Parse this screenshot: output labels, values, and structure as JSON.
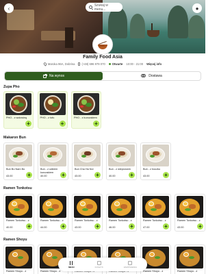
{
  "header": {
    "search_placeholder": "Szukaj w menu..."
  },
  "restaurant": {
    "name": "Family Food Asia",
    "address": "Maroka 96A, Dobrina",
    "phone": "(+48) 696 979 070",
    "status": "Otwarte",
    "hours": "10:00 - 21:00",
    "more_info": "Więcej info"
  },
  "order_toggle": {
    "options": [
      "Na wynos",
      "Dostawa"
    ],
    "active": "Na wynos"
  },
  "sections": [
    {
      "title": "Zupa Pho",
      "items": [
        {
          "name": "PHO - z wołowiną",
          "price": "43.00"
        },
        {
          "name": "PHO - z tofu",
          "price": "40.00"
        },
        {
          "name": "PHO - z kurczakiem",
          "price": "40.00"
        }
      ]
    },
    {
      "title": "Makaron Bun",
      "items": [
        {
          "name": "Bun Bo Nam Bo",
          "price": "43.00"
        },
        {
          "name": "Bun - z udkiem kurczakiem",
          "price": "40.00"
        },
        {
          "name": "Bun Cha Ha Noi",
          "price": "43.00"
        },
        {
          "name": "Bun - z wieprzowin",
          "price": "40.00"
        },
        {
          "name": "Bun - z boczku",
          "price": "43.00"
        }
      ]
    },
    {
      "title": "Ramen Tonkotsu",
      "items": [
        {
          "name": "Ramen Tonkotsu - z",
          "price": "40.00"
        },
        {
          "name": "Ramen Tonkotsu - z",
          "price": "44.00"
        },
        {
          "name": "Ramen Tonkotsu - z",
          "price": "43.00"
        },
        {
          "name": "Ramen Tonkotsu - z",
          "price": "46.00"
        },
        {
          "name": "Ramen Tonkotsu - z",
          "price": "47.00"
        },
        {
          "name": "Ramen Tonkotsu - z",
          "price": "43.00"
        }
      ]
    },
    {
      "title": "Ramen Shoyu",
      "items": [
        {
          "name": "Ramen Shoyu - z",
          "price": ""
        },
        {
          "name": "Ramen Shoyu - z",
          "price": ""
        },
        {
          "name": "Ramen Shoyu - z",
          "price": ""
        },
        {
          "name": "Ramen Shoyu - z",
          "price": ""
        },
        {
          "name": "Ramen Shoyu - z",
          "price": ""
        },
        {
          "name": "Ramen Shoyu - z",
          "price": ""
        }
      ]
    }
  ],
  "bottom_nav": {
    "items": [
      "MENU",
      "KOSZYK",
      "ZAMÓWIENIA"
    ],
    "active": "MENU"
  },
  "colors": {
    "accent_dark_green": "#2f5d1e",
    "add_button_green": "#a9e34b",
    "highlight_card_bg": "#f4fbe3"
  }
}
